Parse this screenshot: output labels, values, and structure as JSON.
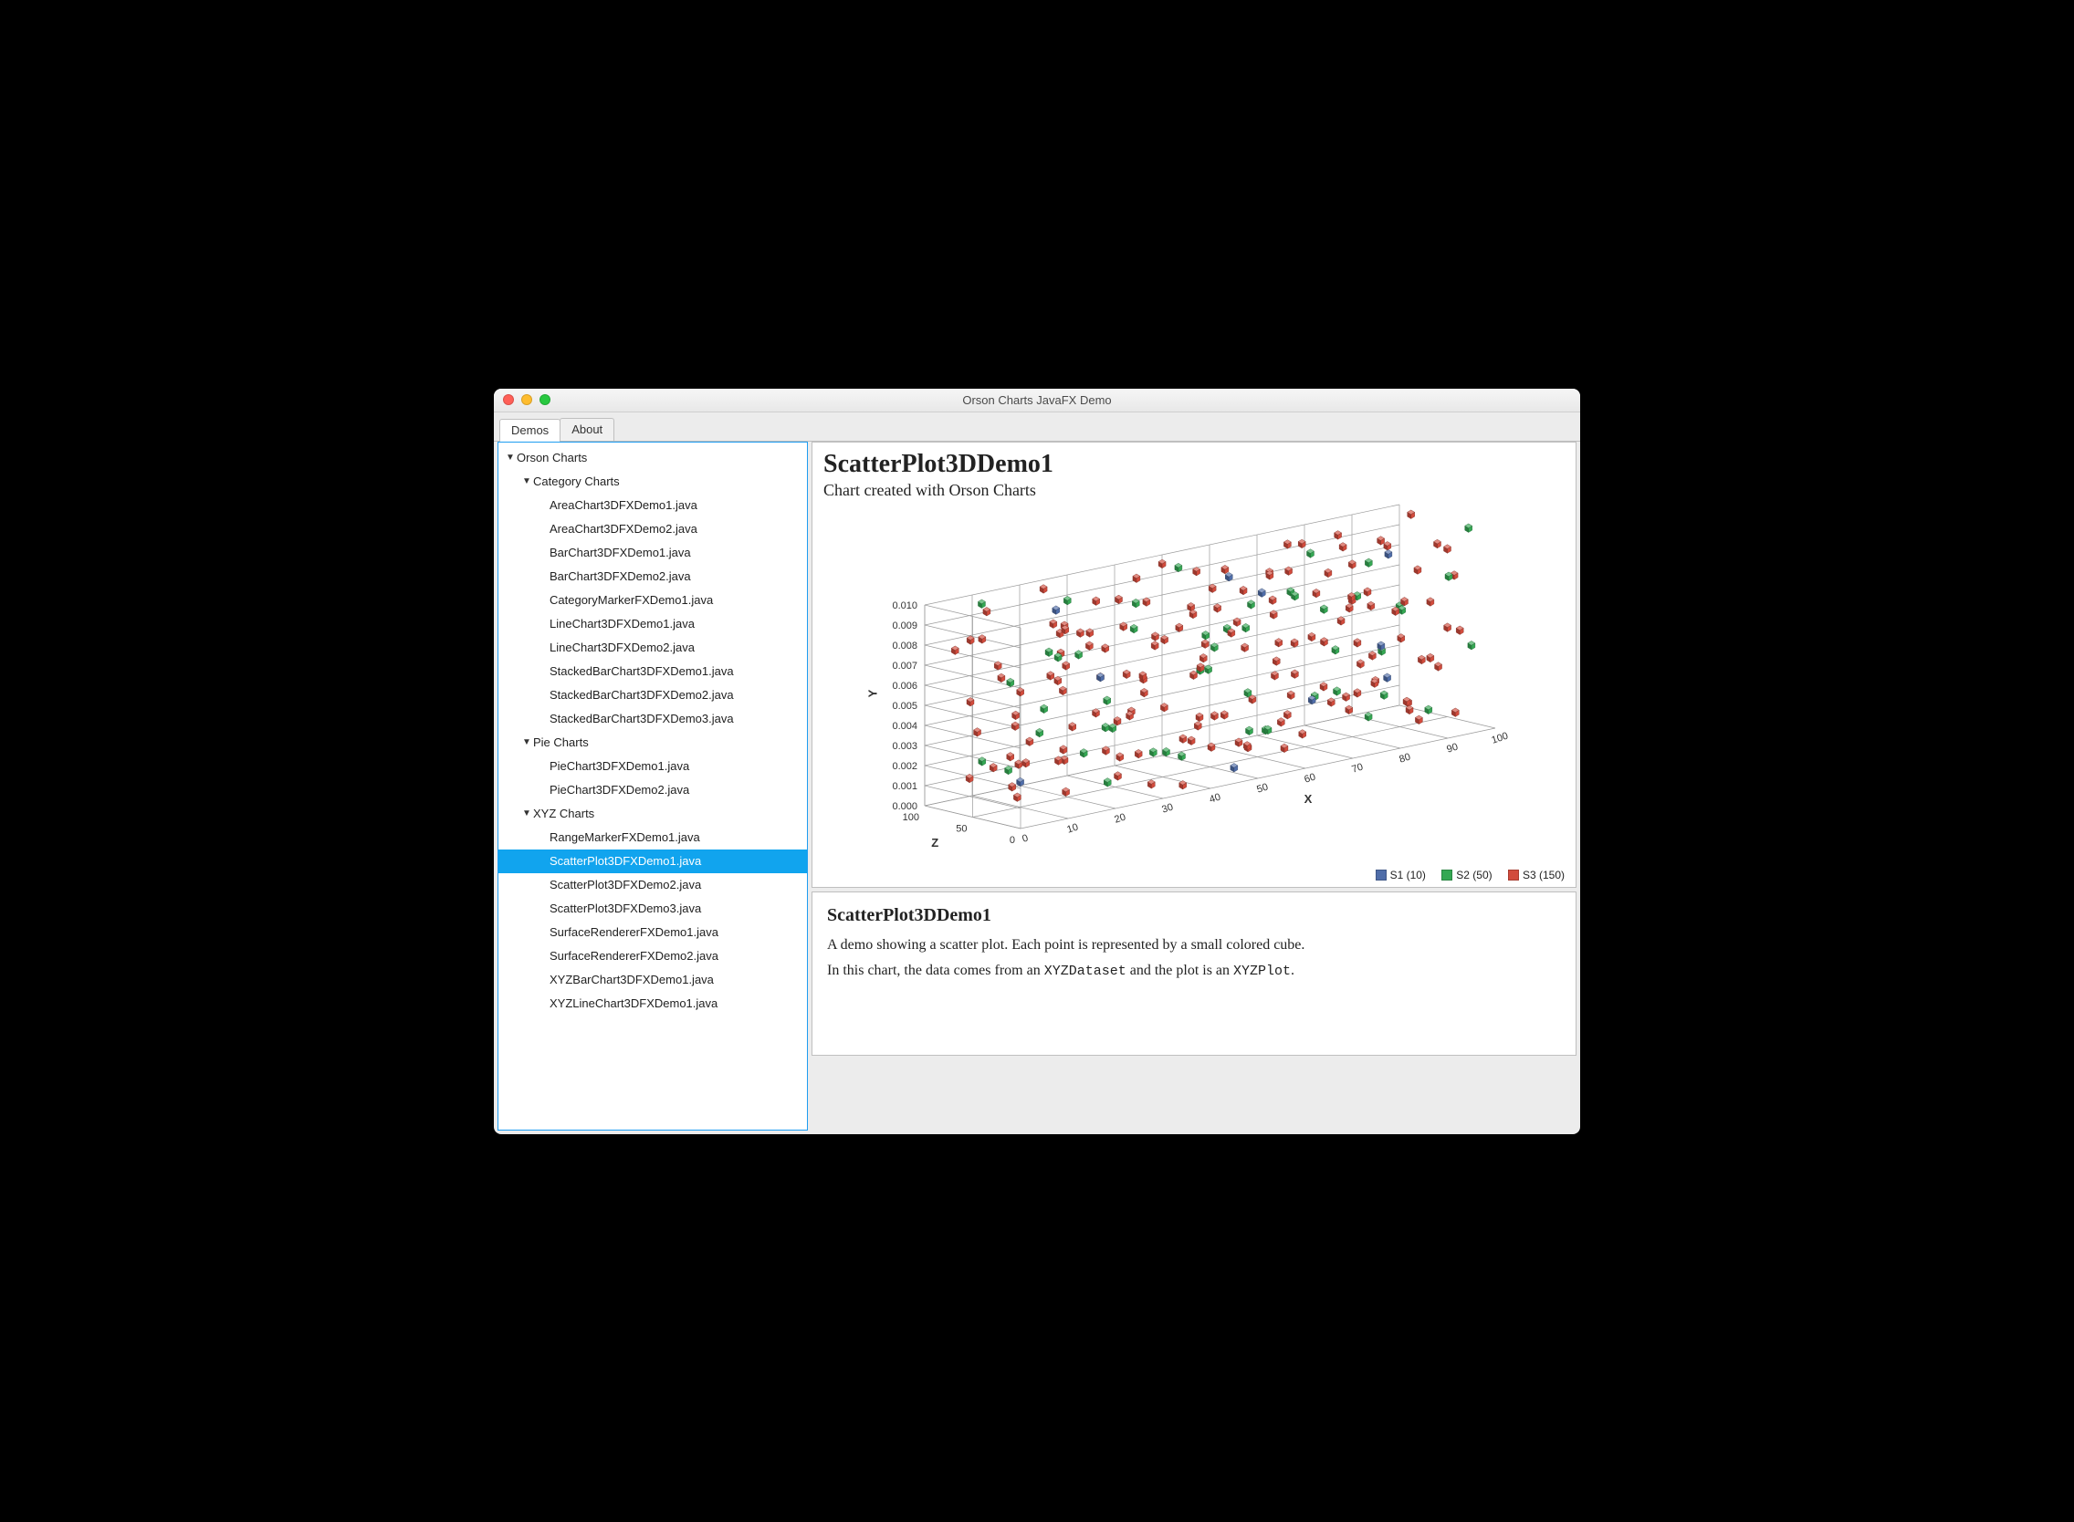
{
  "window": {
    "title": "Orson Charts JavaFX Demo"
  },
  "tabs": {
    "demos": "Demos",
    "about": "About",
    "active": "demos"
  },
  "tree": {
    "root": "Orson Charts",
    "groups": [
      {
        "label": "Category Charts",
        "children": [
          "AreaChart3DFXDemo1.java",
          "AreaChart3DFXDemo2.java",
          "BarChart3DFXDemo1.java",
          "BarChart3DFXDemo2.java",
          "CategoryMarkerFXDemo1.java",
          "LineChart3DFXDemo1.java",
          "LineChart3DFXDemo2.java",
          "StackedBarChart3DFXDemo1.java",
          "StackedBarChart3DFXDemo2.java",
          "StackedBarChart3DFXDemo3.java"
        ]
      },
      {
        "label": "Pie Charts",
        "children": [
          "PieChart3DFXDemo1.java",
          "PieChart3DFXDemo2.java"
        ]
      },
      {
        "label": "XYZ Charts",
        "children": [
          "RangeMarkerFXDemo1.java",
          "ScatterPlot3DFXDemo1.java",
          "ScatterPlot3DFXDemo2.java",
          "ScatterPlot3DFXDemo3.java",
          "SurfaceRendererFXDemo1.java",
          "SurfaceRendererFXDemo2.java",
          "XYZBarChart3DFXDemo1.java",
          "XYZLineChart3DFXDemo1.java"
        ]
      }
    ],
    "selected": "ScatterPlot3DFXDemo1.java"
  },
  "chart": {
    "title": "ScatterPlot3DDemo1",
    "subtitle": "Chart created with Orson Charts",
    "legend": {
      "s1": "S1 (10)",
      "s2": "S2 (50)",
      "s3": "S3 (150)"
    },
    "axes": {
      "x": "X",
      "y": "Y",
      "z": "Z"
    },
    "ticks": {
      "x": [
        "0",
        "10",
        "20",
        "30",
        "40",
        "50",
        "60",
        "70",
        "80",
        "90",
        "100"
      ],
      "y": [
        "0.000",
        "0.001",
        "0.002",
        "0.003",
        "0.004",
        "0.005",
        "0.006",
        "0.007",
        "0.008",
        "0.009",
        "0.010"
      ],
      "z": [
        "0",
        "50",
        "100"
      ]
    },
    "colors": {
      "s1": "#4f6da9",
      "s2": "#34a853",
      "s3": "#d24b3c"
    }
  },
  "description": {
    "heading": "ScatterPlot3DDemo1",
    "p1": "A demo showing a scatter plot. Each point is represented by a small colored cube.",
    "p2a": "In this chart, the data comes from an ",
    "p2code1": "XYZDataset",
    "p2b": " and the plot is an ",
    "p2code2": "XYZPlot",
    "p2c": "."
  },
  "chart_data": {
    "type": "scatter",
    "title": "ScatterPlot3DDemo1",
    "subtitle": "Chart created with Orson Charts",
    "xlabel": "X",
    "ylabel": "Y",
    "zlabel": "Z",
    "xlim": [
      0,
      100
    ],
    "ylim": [
      0.0,
      0.01
    ],
    "zlim": [
      0,
      100
    ],
    "xticks": [
      0,
      10,
      20,
      30,
      40,
      50,
      60,
      70,
      80,
      90,
      100
    ],
    "yticks": [
      0.0,
      0.001,
      0.002,
      0.003,
      0.004,
      0.005,
      0.006,
      0.007,
      0.008,
      0.009,
      0.01
    ],
    "zticks": [
      0,
      50,
      100
    ],
    "series": [
      {
        "name": "S1",
        "count": 10,
        "color": "#4f6da9",
        "points": [
          [
            8,
            0.0015,
            40
          ],
          [
            22,
            0.009,
            72
          ],
          [
            35,
            0.0048,
            90
          ],
          [
            48,
            0.0005,
            15
          ],
          [
            55,
            0.0092,
            55
          ],
          [
            63,
            0.0032,
            8
          ],
          [
            70,
            0.0072,
            95
          ],
          [
            82,
            0.0047,
            30
          ],
          [
            90,
            0.0085,
            62
          ],
          [
            95,
            0.0018,
            88
          ]
        ]
      },
      {
        "name": "S2",
        "count": 50,
        "color": "#34a853",
        "points": [
          [
            4,
            0.0025,
            60
          ],
          [
            9,
            0.0082,
            15
          ],
          [
            12,
            0.005,
            35
          ],
          [
            16,
            0.0011,
            92
          ],
          [
            18,
            0.0071,
            50
          ],
          [
            21,
            0.0039,
            8
          ],
          [
            24,
            0.0094,
            70
          ],
          [
            27,
            0.0005,
            43
          ],
          [
            30,
            0.0062,
            88
          ],
          [
            33,
            0.0019,
            25
          ],
          [
            36,
            0.0088,
            58
          ],
          [
            38,
            0.0034,
            98
          ],
          [
            41,
            0.0075,
            10
          ],
          [
            44,
            0.0009,
            66
          ],
          [
            46,
            0.0053,
            32
          ],
          [
            49,
            0.0097,
            78
          ],
          [
            51,
            0.0022,
            14
          ],
          [
            54,
            0.0067,
            52
          ],
          [
            56,
            0.0041,
            90
          ],
          [
            59,
            0.0086,
            6
          ],
          [
            61,
            0.0014,
            44
          ],
          [
            64,
            0.0059,
            82
          ],
          [
            66,
            0.0031,
            20
          ],
          [
            69,
            0.0077,
            60
          ],
          [
            71,
            0.0003,
            96
          ],
          [
            74,
            0.0048,
            38
          ],
          [
            76,
            0.0091,
            74
          ],
          [
            79,
            0.0026,
            12
          ],
          [
            81,
            0.007,
            50
          ],
          [
            84,
            0.0017,
            86
          ],
          [
            86,
            0.0063,
            28
          ],
          [
            89,
            0.0037,
            64
          ],
          [
            91,
            0.008,
            4
          ],
          [
            94,
            0.0008,
            40
          ],
          [
            96,
            0.0054,
            80
          ],
          [
            98,
            0.0099,
            18
          ],
          [
            5,
            0.0045,
            5
          ],
          [
            14,
            0.0057,
            80
          ],
          [
            29,
            0.003,
            55
          ],
          [
            40,
            0.0013,
            30
          ],
          [
            53,
            0.0083,
            22
          ],
          [
            62,
            0.0029,
            70
          ],
          [
            73,
            0.0068,
            45
          ],
          [
            85,
            0.0007,
            58
          ],
          [
            97,
            0.0042,
            10
          ],
          [
            11,
            0.0096,
            95
          ],
          [
            23,
            0.0021,
            48
          ],
          [
            37,
            0.0074,
            65
          ],
          [
            58,
            0.0052,
            85
          ],
          [
            80,
            0.0089,
            33
          ]
        ]
      },
      {
        "name": "S3",
        "count": 150,
        "color": "#d24b3c",
        "points": [
          [
            2,
            0.003,
            12
          ],
          [
            3,
            0.0087,
            55
          ],
          [
            5,
            0.0014,
            78
          ],
          [
            6,
            0.0062,
            30
          ],
          [
            8,
            0.0049,
            92
          ],
          [
            9,
            0.0006,
            48
          ],
          [
            11,
            0.0093,
            8
          ],
          [
            12,
            0.0038,
            65
          ],
          [
            14,
            0.0072,
            22
          ],
          [
            15,
            0.0019,
            85
          ],
          [
            17,
            0.0056,
            40
          ],
          [
            18,
            0.0001,
            98
          ],
          [
            20,
            0.0081,
            58
          ],
          [
            21,
            0.0027,
            15
          ],
          [
            23,
            0.0068,
            72
          ],
          [
            24,
            0.0044,
            5
          ],
          [
            26,
            0.0095,
            50
          ],
          [
            27,
            0.0011,
            88
          ],
          [
            29,
            0.0059,
            33
          ],
          [
            30,
            0.0035,
            70
          ],
          [
            32,
            0.0078,
            18
          ],
          [
            33,
            0.0003,
            62
          ],
          [
            35,
            0.0091,
            42
          ],
          [
            36,
            0.0047,
            95
          ],
          [
            38,
            0.0024,
            10
          ],
          [
            39,
            0.0066,
            53
          ],
          [
            41,
            0.0008,
            80
          ],
          [
            42,
            0.0083,
            28
          ],
          [
            44,
            0.0031,
            68
          ],
          [
            45,
            0.0075,
            3
          ],
          [
            47,
            0.0052,
            45
          ],
          [
            48,
            0.0098,
            90
          ],
          [
            50,
            0.0016,
            20
          ],
          [
            51,
            0.006,
            60
          ],
          [
            53,
            0.0041,
            82
          ],
          [
            54,
            0.0088,
            35
          ],
          [
            56,
            0.002,
            75
          ],
          [
            57,
            0.0063,
            13
          ],
          [
            59,
            0.0005,
            55
          ],
          [
            60,
            0.0079,
            97
          ],
          [
            62,
            0.0033,
            25
          ],
          [
            63,
            0.007,
            48
          ],
          [
            65,
            0.0048,
            88
          ],
          [
            66,
            0.0094,
            6
          ],
          [
            68,
            0.0012,
            65
          ],
          [
            69,
            0.0057,
            38
          ],
          [
            71,
            0.0085,
            72
          ],
          [
            72,
            0.0028,
            17
          ],
          [
            74,
            0.0074,
            58
          ],
          [
            75,
            0.0009,
            93
          ],
          [
            77,
            0.0051,
            30
          ],
          [
            78,
            0.0096,
            50
          ],
          [
            80,
            0.0022,
            80
          ],
          [
            81,
            0.0067,
            10
          ],
          [
            83,
            0.004,
            44
          ],
          [
            84,
            0.0082,
            70
          ],
          [
            86,
            0.0018,
            23
          ],
          [
            87,
            0.0061,
            85
          ],
          [
            89,
            0.0036,
            5
          ],
          [
            90,
            0.0089,
            63
          ],
          [
            92,
            0.0004,
            40
          ],
          [
            93,
            0.0054,
            95
          ],
          [
            95,
            0.0077,
            18
          ],
          [
            96,
            0.003,
            57
          ],
          [
            98,
            0.0099,
            78
          ],
          [
            99,
            0.0046,
            32
          ],
          [
            3,
            0.0053,
            20
          ],
          [
            7,
            0.0097,
            70
          ],
          [
            10,
            0.0023,
            44
          ],
          [
            13,
            0.0065,
            88
          ],
          [
            16,
            0.0007,
            32
          ],
          [
            19,
            0.0086,
            60
          ],
          [
            22,
            0.0042,
            8
          ],
          [
            25,
            0.0073,
            52
          ],
          [
            28,
            0.0015,
            94
          ],
          [
            31,
            0.0058,
            26
          ],
          [
            34,
            0.009,
            66
          ],
          [
            37,
            0.0002,
            14
          ],
          [
            40,
            0.0069,
            48
          ],
          [
            43,
            0.0037,
            84
          ],
          [
            46,
            0.008,
            2
          ],
          [
            49,
            0.0025,
            56
          ],
          [
            52,
            0.0064,
            92
          ],
          [
            55,
            0.001,
            36
          ],
          [
            58,
            0.0092,
            74
          ],
          [
            61,
            0.0045,
            16
          ],
          [
            64,
            0.0076,
            54
          ],
          [
            67,
            0.0021,
            90
          ],
          [
            70,
            0.0055,
            30
          ],
          [
            73,
            0.0098,
            68
          ],
          [
            76,
            0.0034,
            7
          ],
          [
            79,
            0.0071,
            46
          ],
          [
            82,
            0.0013,
            82
          ],
          [
            85,
            0.005,
            24
          ],
          [
            88,
            0.0093,
            60
          ],
          [
            91,
            0.0026,
            96
          ],
          [
            94,
            0.0062,
            38
          ],
          [
            97,
            0.0006,
            76
          ],
          [
            100,
            0.0084,
            50
          ],
          [
            4,
            0.0039,
            65
          ],
          [
            6,
            0.0075,
            98
          ],
          [
            12,
            0.0032,
            50
          ],
          [
            17,
            0.0088,
            12
          ],
          [
            23,
            0.0054,
            75
          ],
          [
            29,
            0.0017,
            40
          ],
          [
            35,
            0.0063,
            85
          ],
          [
            41,
            0.0029,
            18
          ],
          [
            47,
            0.0081,
            55
          ],
          [
            53,
            0.0008,
            93
          ],
          [
            59,
            0.0044,
            27
          ],
          [
            65,
            0.0087,
            62
          ],
          [
            71,
            0.0023,
            9
          ],
          [
            77,
            0.006,
            47
          ],
          [
            83,
            0.0096,
            80
          ],
          [
            89,
            0.0011,
            35
          ],
          [
            95,
            0.0058,
            70
          ],
          [
            2,
            0.0071,
            30
          ],
          [
            8,
            0.0019,
            68
          ],
          [
            14,
            0.009,
            7
          ],
          [
            20,
            0.0036,
            45
          ],
          [
            26,
            0.0079,
            83
          ],
          [
            32,
            0.0004,
            22
          ],
          [
            38,
            0.0049,
            60
          ],
          [
            44,
            0.0092,
            97
          ],
          [
            50,
            0.0028,
            35
          ],
          [
            56,
            0.0074,
            72
          ],
          [
            62,
            0.0015,
            13
          ],
          [
            68,
            0.0053,
            51
          ],
          [
            74,
            0.0095,
            88
          ],
          [
            80,
            0.0031,
            26
          ],
          [
            86,
            0.0068,
            64
          ],
          [
            92,
            0.0012,
            2
          ],
          [
            98,
            0.0047,
            40
          ],
          [
            5,
            0.0083,
            77
          ],
          [
            11,
            0.0027,
            15
          ],
          [
            17,
            0.0062,
            53
          ],
          [
            23,
            0.0098,
            90
          ],
          [
            29,
            0.0041,
            28
          ],
          [
            35,
            0.0076,
            66
          ],
          [
            41,
            0.002,
            4
          ],
          [
            47,
            0.0057,
            42
          ],
          [
            53,
            0.0093,
            79
          ],
          [
            59,
            0.0009,
            17
          ],
          [
            65,
            0.0045,
            55
          ],
          [
            71,
            0.0082,
            92
          ],
          [
            77,
            0.0026,
            30
          ],
          [
            83,
            0.0061,
            68
          ],
          [
            89,
            0.0097,
            6
          ],
          [
            95,
            0.0033,
            43
          ],
          [
            100,
            0.007,
            81
          ]
        ]
      }
    ]
  }
}
